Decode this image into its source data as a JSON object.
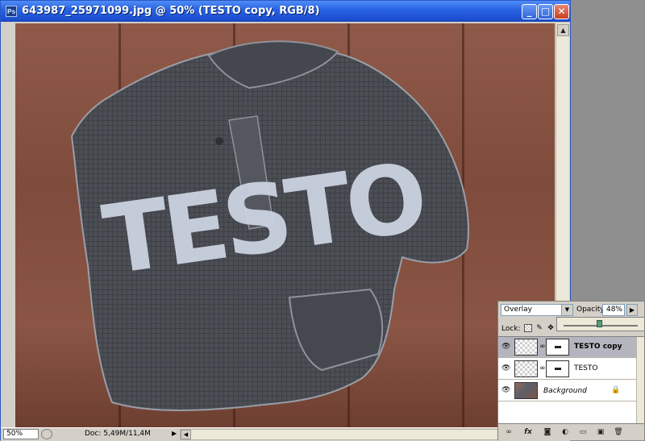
{
  "window": {
    "title": "643987_25971099.jpg @ 50% (TESTO copy, RGB/8)",
    "app_icon_label": "Ps",
    "min_label": "_",
    "max_label": "□",
    "close_label": "✕"
  },
  "canvas": {
    "shirt_text": "TESTO"
  },
  "statusbar": {
    "zoom": "50%",
    "doc_info": "Doc: 5,49M/11,4M",
    "arrow": "▶"
  },
  "layers_panel": {
    "blend_mode": "Overlay",
    "opacity_label": "Opacity:",
    "opacity_value": "48%",
    "opacity_fraction": 0.48,
    "lock_label": "Lock:",
    "layers": [
      {
        "name": "TESTO copy",
        "selected": true
      },
      {
        "name": "TESTO",
        "selected": false
      },
      {
        "name": "Background",
        "selected": false
      }
    ]
  },
  "colors": {
    "titlebar": "#2a64e3",
    "selected_layer": "#b5b5bf",
    "shirt": "#4b4d53",
    "letters": "#cfd7e6"
  }
}
